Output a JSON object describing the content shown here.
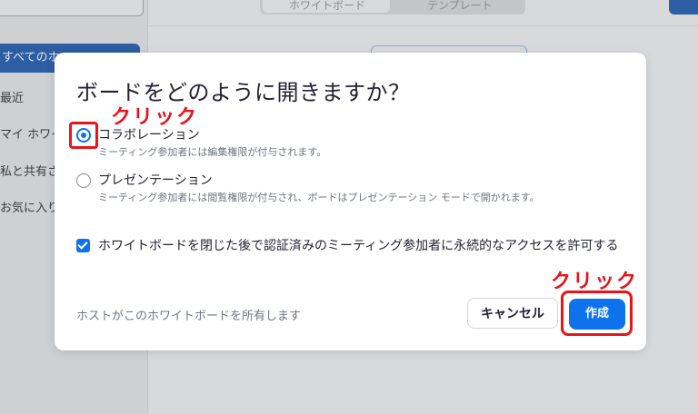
{
  "background": {
    "segmented": [
      "ホワイトボード",
      "テンプレート"
    ],
    "active_nav": "すべてのホ",
    "nav_items": [
      "最近",
      "マイ ホワイ",
      "私と共有さ",
      "お気に入り"
    ]
  },
  "dialog": {
    "title": "ボードをどのように開きますか？",
    "options": [
      {
        "label": "コラボレーション",
        "description": "ミーティング参加者には編集権限が付与されます。",
        "selected": true
      },
      {
        "label": "プレゼンテーション",
        "description": "ミーティング参加者には閲覧権限が付与され、ボードはプレゼンテーション モードで開かれます。",
        "selected": false
      }
    ],
    "checkbox_label": "ホワイトボードを閉じた後で認証済みのミーティング参加者に永続的なアクセスを許可する",
    "checkbox_checked": true,
    "host_text": "ホストがこのホワイトボードを所有します",
    "cancel_label": "キャンセル",
    "create_label": "作成"
  },
  "annotations": {
    "click_label_1": "クリック",
    "click_label_2": "クリック",
    "color": "#e8141c"
  },
  "colors": {
    "accent": "#0e72ed",
    "text": "#232333",
    "muted": "#6e7680"
  }
}
